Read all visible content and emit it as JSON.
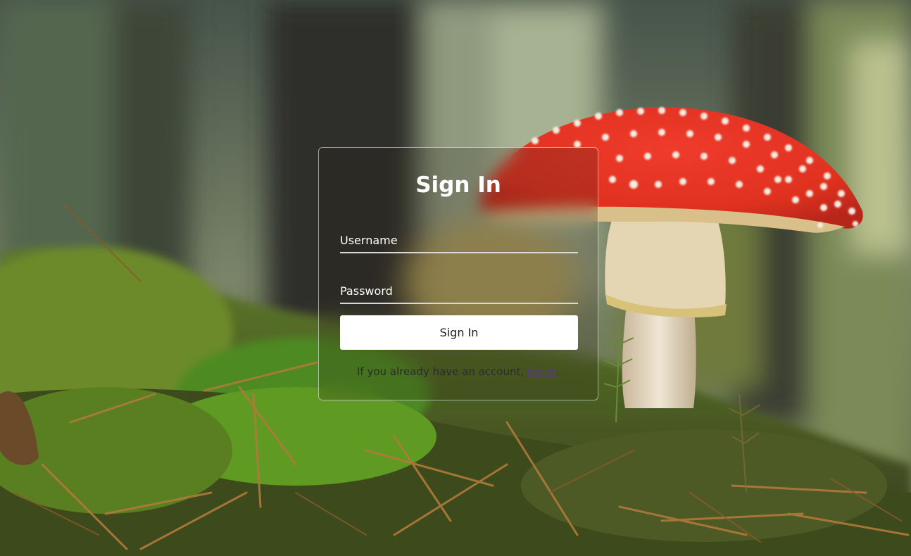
{
  "form": {
    "title": "Sign In",
    "username_placeholder": "Username",
    "password_placeholder": "Password",
    "submit_label": "Sign In",
    "footer_prefix": "If you already have an account, ",
    "footer_link": "log in",
    "footer_suffix": "."
  },
  "colors": {
    "card_border": "#ffffff",
    "button_bg": "#ffffff",
    "link": "#5b3a8a"
  }
}
